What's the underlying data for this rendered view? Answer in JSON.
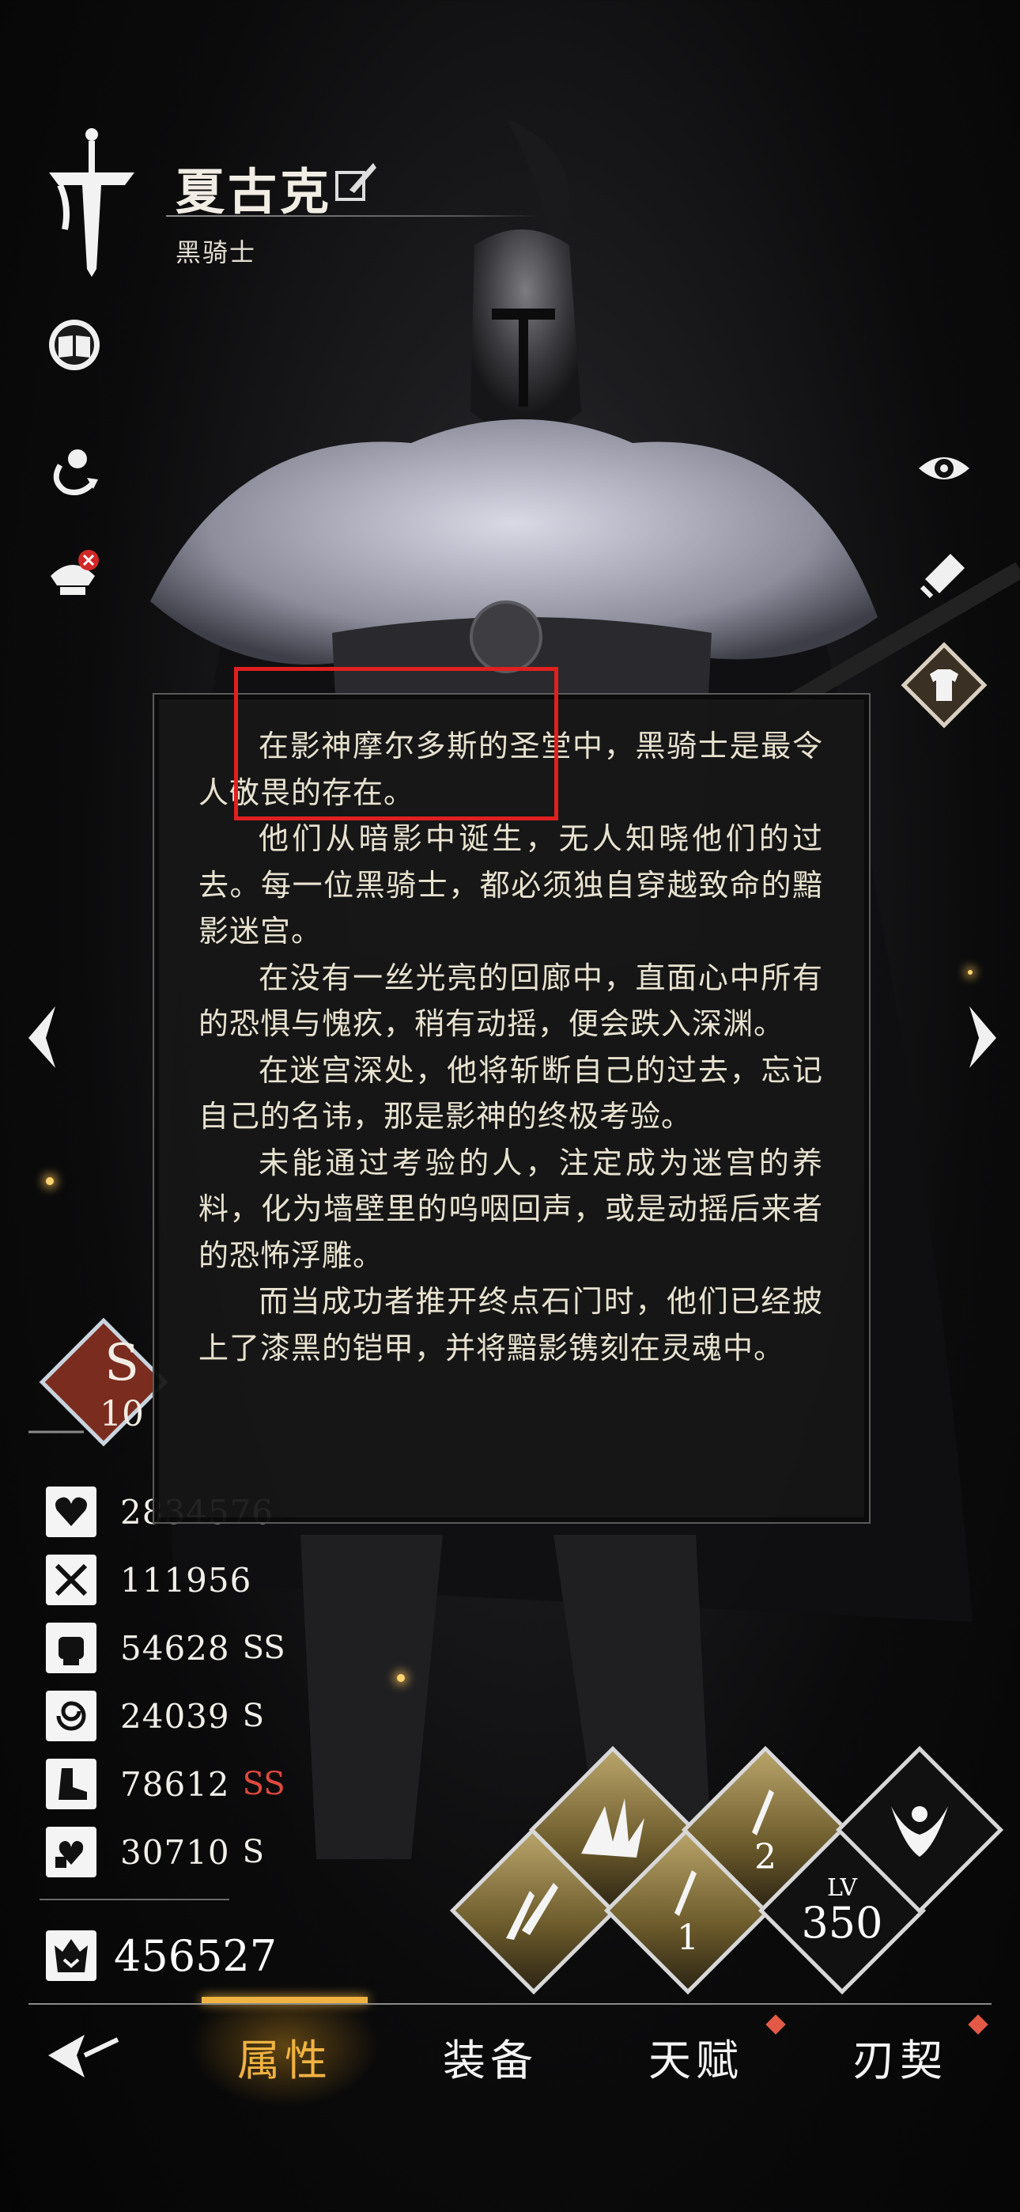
{
  "hero": {
    "name": "夏古克",
    "class_title": "黑骑士"
  },
  "description": [
    "在影神摩尔多斯的圣堂中，黑骑士是最令人敬畏的存在。",
    "他们从暗影中诞生，无人知晓他们的过去。每一位黑骑士，都必须独自穿越致命的黯影迷宫。",
    "在没有一丝光亮的回廊中，直面心中所有的恐惧与愧疚，稍有动摇，便会跌入深渊。",
    "在迷宫深处，他将斩断自己的过去，忘记自己的名讳，那是影神的终极考验。",
    "未能通过考验的人，注定成为迷宫的养料，化为墙壁里的呜咽回声，或是动摇后来者的恐怖浮雕。",
    "而当成功者推开终点石门时，他们已经披上了漆黑的铠甲，并将黯影镌刻在灵魂中。"
  ],
  "rank_badge": {
    "letter": "S",
    "number": "10"
  },
  "stats": [
    {
      "icon": "heart-icon",
      "value": "2834576",
      "grade": "",
      "grade_color": ""
    },
    {
      "icon": "crossed-swords-icon",
      "value": "111956",
      "grade": "",
      "grade_color": ""
    },
    {
      "icon": "fist-icon",
      "value": "54628",
      "grade": "SS",
      "grade_color": "#f2efe8"
    },
    {
      "icon": "swirl-icon",
      "value": "24039",
      "grade": "S",
      "grade_color": "#f2efe8"
    },
    {
      "icon": "boot-icon",
      "value": "78612",
      "grade": "SS",
      "grade_color": "#e0493e"
    },
    {
      "icon": "heart-hand-icon",
      "value": "30710",
      "grade": "S",
      "grade_color": "#f2efe8"
    }
  ],
  "combat_power": "456527",
  "level": {
    "label": "LV",
    "value": "350"
  },
  "skills": {
    "skill_1_label": "1",
    "skill_2_label": "2"
  },
  "nav": {
    "tabs": [
      "属性",
      "装备",
      "天赋",
      "刃契"
    ],
    "active_index": 0
  },
  "colors": {
    "accent": "#f0b341",
    "highlight": "#e02020",
    "notify": "#e25a45"
  }
}
